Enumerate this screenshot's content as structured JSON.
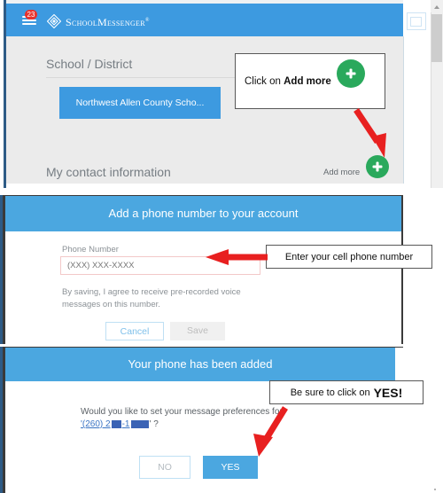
{
  "app": {
    "brand": "SchoolMessenger",
    "brand_sup": "®",
    "notification_count": "23",
    "menu_icon": "hamburger-icon",
    "card_icon": "id-card-icon",
    "headings": {
      "school_district": "School / District",
      "my_contact_information": "My contact information"
    },
    "district_button": "Northwest Allen County Scho...",
    "add_more_label": "Add more",
    "colors": {
      "brand_blue": "#3d9ae0",
      "header_blue": "#4ba7e0",
      "green_fab": "#2aa95c",
      "badge_red": "#e8322c",
      "page_grey": "#ebebeb"
    }
  },
  "callouts": {
    "add_more": {
      "text_prefix": "Click on ",
      "text_bold": "Add more"
    },
    "phone": {
      "text": "Enter your cell phone number"
    },
    "yes": {
      "text_prefix": "Be sure to click on ",
      "text_bold": "YES!"
    }
  },
  "add_phone_modal": {
    "title": "Add a phone number to your account",
    "phone_label": "Phone Number",
    "phone_placeholder": "(XXX) XXX-XXXX",
    "phone_value": "",
    "consent_text": "By saving, I agree to receive pre-recorded voice messages on this number.",
    "cancel_label": "Cancel",
    "save_label": "Save"
  },
  "confirm_modal": {
    "title": "Your phone has been added",
    "question": "Would you like to set your message preferences for",
    "phone_prefix": "'(260) 2",
    "phone_middle": "-1",
    "phone_suffix": "' ?",
    "no_label": "NO",
    "yes_label": "YES"
  }
}
